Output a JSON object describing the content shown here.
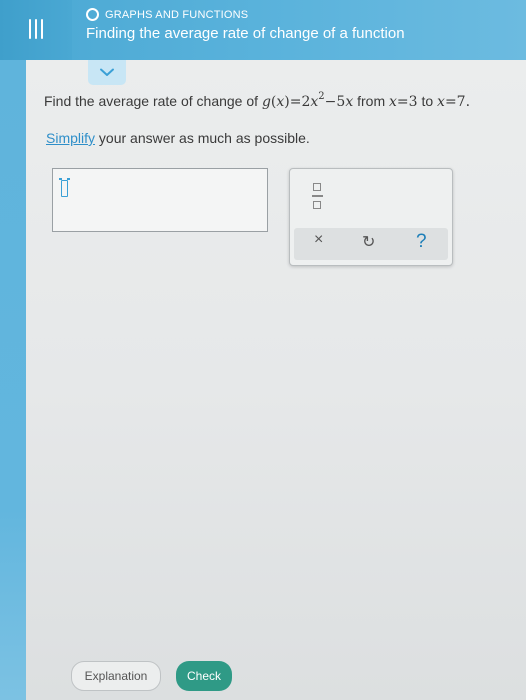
{
  "header": {
    "topic": "GRAPHS AND FUNCTIONS",
    "title": "Finding the average rate of change of a function"
  },
  "question": {
    "prefix": "Find the average rate of change of",
    "func": "g",
    "lparen": "(",
    "var": "x",
    "rparen_eq": ")=2",
    "x1": "x",
    "exponent": "2",
    "minus": "−",
    "term2": "5",
    "x2": "x",
    "from": "from",
    "xa": "x",
    "eq_a": "=3",
    "to": "to",
    "xb": "x",
    "eq_b": "=7."
  },
  "instruction": {
    "link": "Simplify",
    "rest": "your answer as much as possible."
  },
  "toolbox": {
    "clear": "×",
    "undo": "↻",
    "help": "?"
  },
  "buttons": {
    "explanation": "Explanation",
    "check": "Check"
  },
  "colors": {
    "header": "#4aa8d3",
    "check": "#2f9a86",
    "link": "#2f8fc9"
  }
}
